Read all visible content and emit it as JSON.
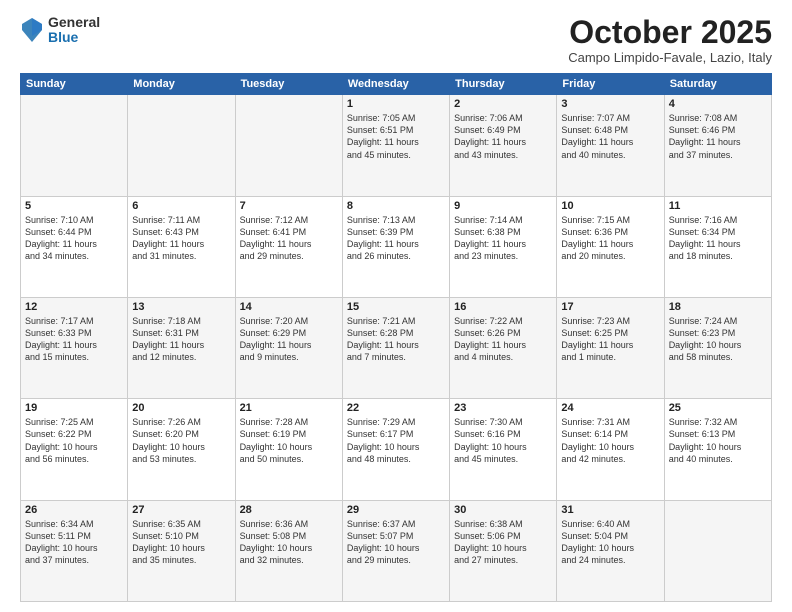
{
  "header": {
    "logo_general": "General",
    "logo_blue": "Blue",
    "month_title": "October 2025",
    "subtitle": "Campo Limpido-Favale, Lazio, Italy"
  },
  "weekdays": [
    "Sunday",
    "Monday",
    "Tuesday",
    "Wednesday",
    "Thursday",
    "Friday",
    "Saturday"
  ],
  "weeks": [
    [
      {
        "day": "",
        "info": ""
      },
      {
        "day": "",
        "info": ""
      },
      {
        "day": "",
        "info": ""
      },
      {
        "day": "1",
        "info": "Sunrise: 7:05 AM\nSunset: 6:51 PM\nDaylight: 11 hours\nand 45 minutes."
      },
      {
        "day": "2",
        "info": "Sunrise: 7:06 AM\nSunset: 6:49 PM\nDaylight: 11 hours\nand 43 minutes."
      },
      {
        "day": "3",
        "info": "Sunrise: 7:07 AM\nSunset: 6:48 PM\nDaylight: 11 hours\nand 40 minutes."
      },
      {
        "day": "4",
        "info": "Sunrise: 7:08 AM\nSunset: 6:46 PM\nDaylight: 11 hours\nand 37 minutes."
      }
    ],
    [
      {
        "day": "5",
        "info": "Sunrise: 7:10 AM\nSunset: 6:44 PM\nDaylight: 11 hours\nand 34 minutes."
      },
      {
        "day": "6",
        "info": "Sunrise: 7:11 AM\nSunset: 6:43 PM\nDaylight: 11 hours\nand 31 minutes."
      },
      {
        "day": "7",
        "info": "Sunrise: 7:12 AM\nSunset: 6:41 PM\nDaylight: 11 hours\nand 29 minutes."
      },
      {
        "day": "8",
        "info": "Sunrise: 7:13 AM\nSunset: 6:39 PM\nDaylight: 11 hours\nand 26 minutes."
      },
      {
        "day": "9",
        "info": "Sunrise: 7:14 AM\nSunset: 6:38 PM\nDaylight: 11 hours\nand 23 minutes."
      },
      {
        "day": "10",
        "info": "Sunrise: 7:15 AM\nSunset: 6:36 PM\nDaylight: 11 hours\nand 20 minutes."
      },
      {
        "day": "11",
        "info": "Sunrise: 7:16 AM\nSunset: 6:34 PM\nDaylight: 11 hours\nand 18 minutes."
      }
    ],
    [
      {
        "day": "12",
        "info": "Sunrise: 7:17 AM\nSunset: 6:33 PM\nDaylight: 11 hours\nand 15 minutes."
      },
      {
        "day": "13",
        "info": "Sunrise: 7:18 AM\nSunset: 6:31 PM\nDaylight: 11 hours\nand 12 minutes."
      },
      {
        "day": "14",
        "info": "Sunrise: 7:20 AM\nSunset: 6:29 PM\nDaylight: 11 hours\nand 9 minutes."
      },
      {
        "day": "15",
        "info": "Sunrise: 7:21 AM\nSunset: 6:28 PM\nDaylight: 11 hours\nand 7 minutes."
      },
      {
        "day": "16",
        "info": "Sunrise: 7:22 AM\nSunset: 6:26 PM\nDaylight: 11 hours\nand 4 minutes."
      },
      {
        "day": "17",
        "info": "Sunrise: 7:23 AM\nSunset: 6:25 PM\nDaylight: 11 hours\nand 1 minute."
      },
      {
        "day": "18",
        "info": "Sunrise: 7:24 AM\nSunset: 6:23 PM\nDaylight: 10 hours\nand 58 minutes."
      }
    ],
    [
      {
        "day": "19",
        "info": "Sunrise: 7:25 AM\nSunset: 6:22 PM\nDaylight: 10 hours\nand 56 minutes."
      },
      {
        "day": "20",
        "info": "Sunrise: 7:26 AM\nSunset: 6:20 PM\nDaylight: 10 hours\nand 53 minutes."
      },
      {
        "day": "21",
        "info": "Sunrise: 7:28 AM\nSunset: 6:19 PM\nDaylight: 10 hours\nand 50 minutes."
      },
      {
        "day": "22",
        "info": "Sunrise: 7:29 AM\nSunset: 6:17 PM\nDaylight: 10 hours\nand 48 minutes."
      },
      {
        "day": "23",
        "info": "Sunrise: 7:30 AM\nSunset: 6:16 PM\nDaylight: 10 hours\nand 45 minutes."
      },
      {
        "day": "24",
        "info": "Sunrise: 7:31 AM\nSunset: 6:14 PM\nDaylight: 10 hours\nand 42 minutes."
      },
      {
        "day": "25",
        "info": "Sunrise: 7:32 AM\nSunset: 6:13 PM\nDaylight: 10 hours\nand 40 minutes."
      }
    ],
    [
      {
        "day": "26",
        "info": "Sunrise: 6:34 AM\nSunset: 5:11 PM\nDaylight: 10 hours\nand 37 minutes."
      },
      {
        "day": "27",
        "info": "Sunrise: 6:35 AM\nSunset: 5:10 PM\nDaylight: 10 hours\nand 35 minutes."
      },
      {
        "day": "28",
        "info": "Sunrise: 6:36 AM\nSunset: 5:08 PM\nDaylight: 10 hours\nand 32 minutes."
      },
      {
        "day": "29",
        "info": "Sunrise: 6:37 AM\nSunset: 5:07 PM\nDaylight: 10 hours\nand 29 minutes."
      },
      {
        "day": "30",
        "info": "Sunrise: 6:38 AM\nSunset: 5:06 PM\nDaylight: 10 hours\nand 27 minutes."
      },
      {
        "day": "31",
        "info": "Sunrise: 6:40 AM\nSunset: 5:04 PM\nDaylight: 10 hours\nand 24 minutes."
      },
      {
        "day": "",
        "info": ""
      }
    ]
  ]
}
